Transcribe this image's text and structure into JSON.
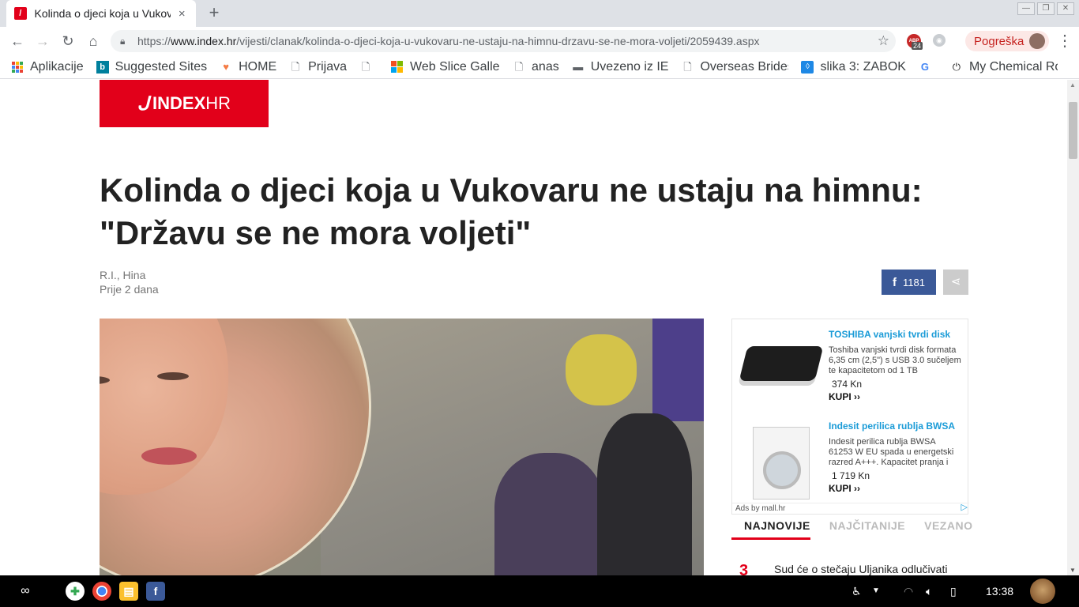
{
  "browser": {
    "tab_title": "Kolinda o djeci koja u Vukovaru ne ustaju na himnu",
    "tab_close": "×",
    "new_tab": "+",
    "url_scheme": "https://",
    "url_domain": "www.index.hr",
    "url_path": "/vijesti/clanak/kolinda-o-djeci-koja-u-vukovaru-ne-ustaju-na-himnu-drzavu-se-ne-mora-voljeti/2059439.aspx",
    "extension_badge": "24",
    "extension_label": "ABP",
    "profile_status": "Pogreška",
    "bookmarks": [
      {
        "label": "Aplikacije",
        "icon": "apps-icon"
      },
      {
        "label": "Suggested Sites",
        "icon": "bing-icon"
      },
      {
        "label": "HOME",
        "icon": "heart-icon"
      },
      {
        "label": "Prijava",
        "icon": "page-icon"
      },
      {
        "label": "",
        "icon": "page-icon"
      },
      {
        "label": "Web Slice Galler",
        "icon": "windows-icon"
      },
      {
        "label": "anas",
        "icon": "page-icon"
      },
      {
        "label": "Uvezeno iz IE",
        "icon": "folder-icon"
      },
      {
        "label": "Overseas Brides",
        "icon": "page-icon"
      },
      {
        "label": "slika 3: ZABOK",
        "icon": "dropbox-icon"
      },
      {
        "label": "",
        "icon": "google-icon"
      },
      {
        "label": "My Chemical Ro",
        "icon": "power-icon"
      }
    ]
  },
  "site": {
    "logo_index": "INDEX",
    "logo_hr": "HR"
  },
  "article": {
    "title": "Kolinda o djeci koja u Vukovaru ne ustaju na himnu: \"Državu se ne mora voljeti\"",
    "author": "R.I., Hina",
    "date": "Prije 2 dana",
    "facebook_count": "1181"
  },
  "ad": {
    "items": [
      {
        "title": "TOSHIBA vanjski tvrdi disk",
        "description": "Toshiba vanjski tvrdi disk formata 6,35 cm (2,5\") s USB 3.0 sučeljem te kapacitetom od 1 TB",
        "price": "374 Kn",
        "cta": "KUPI ››"
      },
      {
        "title": "Indesit perilica rublja BWSA",
        "description": "Indesit perilica rublja BWSA 61253 W EU spada u energetski razred A+++. Kapacitet pranja i",
        "price": "1 719 Kn",
        "cta": "KUPI ››"
      }
    ],
    "footer": "Ads by mall.hr"
  },
  "sidebar_tabs": [
    "NAJNOVIJE",
    "NAJČITANIJE",
    "VEZANO"
  ],
  "news": [
    {
      "num": "3",
      "text": "Sud će o stečaju Uljanika odlučivati"
    }
  ],
  "shelf": {
    "time": "13:38"
  },
  "colors": {
    "brand": "#e2001a",
    "facebook": "#3b5998",
    "ad_title": "#1a9bd7"
  }
}
